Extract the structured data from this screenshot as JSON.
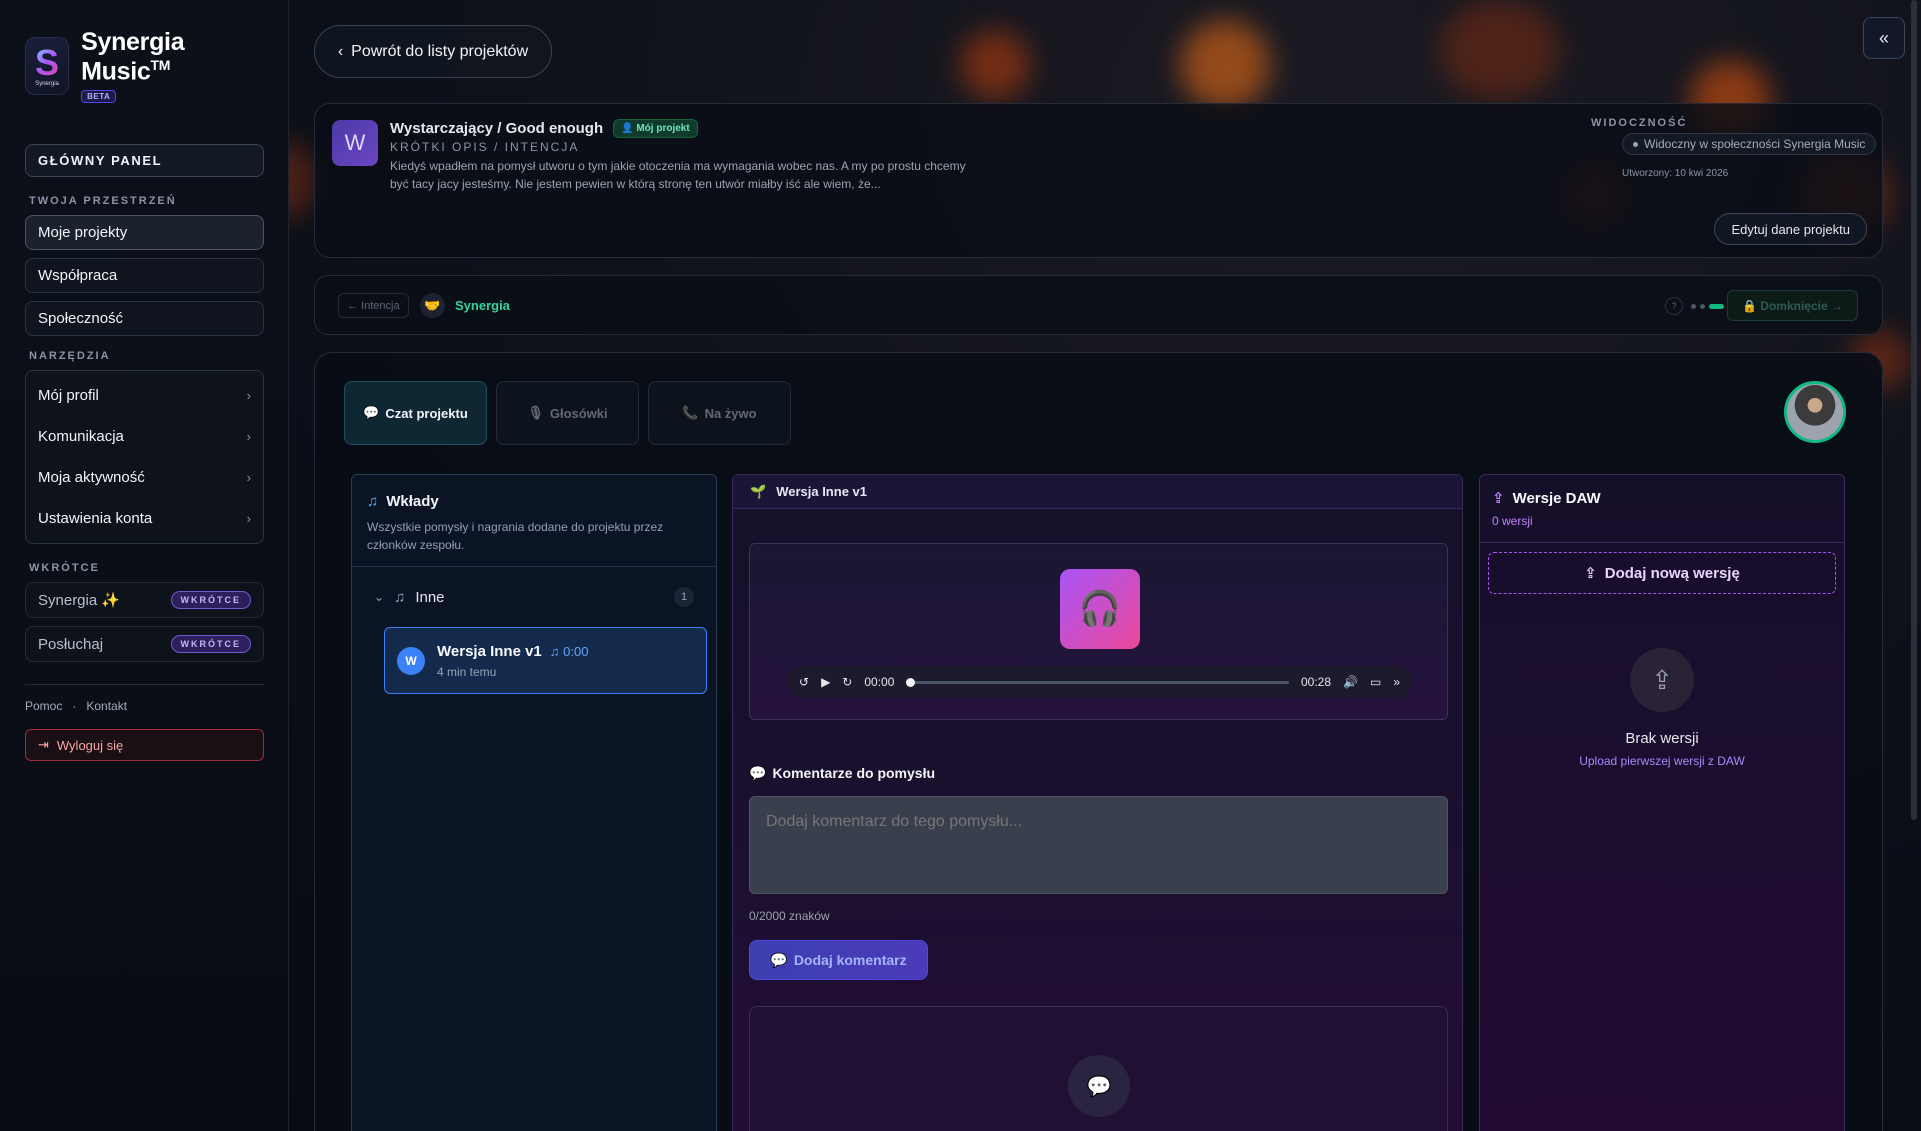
{
  "brand": {
    "name": "Synergia Music",
    "tm": "TM",
    "beta": "BETA",
    "logo_letter": "S",
    "logo_small": "Synergia"
  },
  "sidebar": {
    "main_panel": "GŁÓWNY PANEL",
    "section_space": "TWOJA PRZESTRZEŃ",
    "space_items": [
      {
        "label": "Moje projekty",
        "active": true
      },
      {
        "label": "Współpraca"
      },
      {
        "label": "Społeczność"
      }
    ],
    "section_tools": "NARZĘDZIA",
    "tool_items": [
      {
        "label": "Mój profil"
      },
      {
        "label": "Komunikacja"
      },
      {
        "label": "Moja aktywność"
      },
      {
        "label": "Ustawienia konta"
      }
    ],
    "section_soon": "WKRÓTCE",
    "soon_items": [
      {
        "label": "Synergia ✨",
        "badge": "WKRÓTCE"
      },
      {
        "label": "Posłuchaj",
        "badge": "WKRÓTCE"
      }
    ],
    "help": "Pomoc",
    "dot": "·",
    "contact": "Kontakt",
    "logout": "Wyloguj się"
  },
  "header": {
    "back_label": "Powrót do listy projektów",
    "collapse_icon": "«"
  },
  "project": {
    "avatar": "W",
    "title": "Wystarczający / Good enough",
    "my_badge": "Mój projekt",
    "subtitle": "KRÓTKI OPIS / INTENCJA",
    "description": "Kiedyś wpadłem na pomysł utworu o tym jakie otoczenia ma wymagania wobec nas. A my po prostu chcemy być tacy jacy jesteśmy. Nie jestem pewien w którą stronę ten utwór miałby iść ale wiem, że...",
    "visibility_label": "WIDOCZNOŚĆ",
    "visibility_value": "Widoczny w społeczności Synergia Music",
    "created": "Utworzony: 10 kwi 2026",
    "edit_label": "Edytuj dane projektu"
  },
  "stage": {
    "prev": "← Intencja",
    "icon": "🤝",
    "current": "Synergia",
    "help": "?",
    "next": "🔒 Domknięcie →",
    "progress": {
      "total_steps": 5,
      "current_step": 3
    }
  },
  "tabs": [
    {
      "icon": "💬",
      "label": "Czat projektu",
      "active": true
    },
    {
      "icon": "🎙",
      "label": "Głosówki"
    },
    {
      "icon": "📞",
      "label": "Na żywo"
    }
  ],
  "contributions": {
    "title": "Wkłady",
    "description": "Wszystkie pomysły i nagrania dodane do projektu przez członków zespołu.",
    "group": {
      "name": "Inne",
      "count": "1"
    },
    "item": {
      "avatar": "W",
      "title": "Wersja Inne v1",
      "duration": "0:00",
      "time": "4 min temu"
    }
  },
  "player": {
    "header": "Wersja Inne v1",
    "current_time": "00:00",
    "total_time": "00:28",
    "progress": 0
  },
  "comments": {
    "title": "Komentarze do pomysłu",
    "placeholder": "Dodaj komentarz do tego pomysłu...",
    "char_count": "0/2000 znaków",
    "add_label": "Dodaj komentarz"
  },
  "daw": {
    "title": "Wersje DAW",
    "count": "0 wersji",
    "add_label": "Dodaj nową wersję",
    "empty_title": "Brak wersji",
    "empty_sub": "Upload pierwszej wersji z DAW"
  }
}
